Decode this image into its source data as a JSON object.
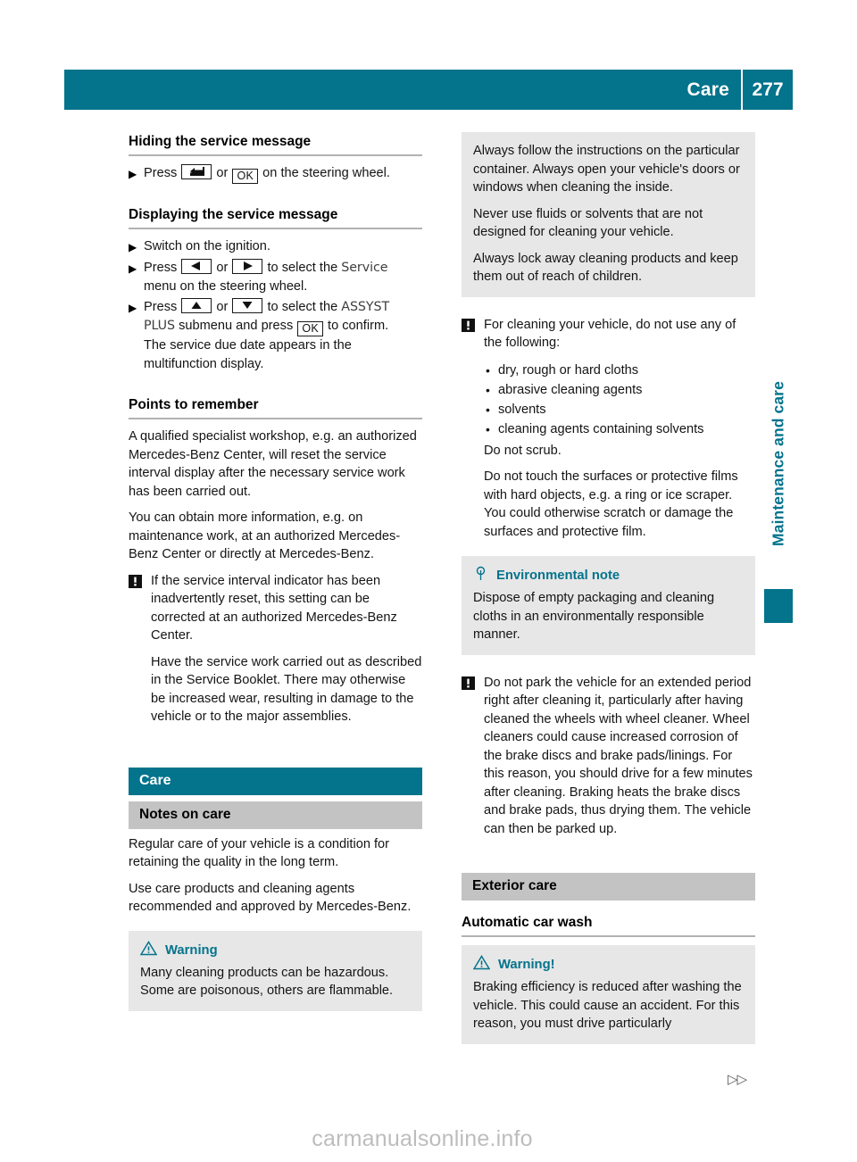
{
  "header": {
    "title": "Care",
    "page_number": "277",
    "accent_color": "#04738c"
  },
  "side_tab": {
    "label": "Maintenance and care"
  },
  "left_column": {
    "section_1": {
      "heading": "Hiding the service message",
      "steps": [
        {
          "parts": [
            {
              "type": "text",
              "value": "Press "
            },
            {
              "type": "key",
              "icon": "back-key-icon"
            },
            {
              "type": "text",
              "value": " or "
            },
            {
              "type": "key",
              "label": "OK"
            },
            {
              "type": "text",
              "value": " on the steering wheel."
            }
          ]
        }
      ]
    },
    "section_2": {
      "heading": "Displaying the service message",
      "step_1": "Switch on the ignition.",
      "step_2_a": "Press ",
      "step_2_or": " or ",
      "step_2_b": " to select the ",
      "step_2_mono": "Service",
      "step_2_c": "menu on the steering wheel.",
      "step_3_a": "Press ",
      "step_3_or": " or ",
      "step_3_b": " to select the ",
      "step_3_mono1": "ASSYST",
      "step_3_mono2": "PLUS",
      "step_3_c": " submenu and press ",
      "step_3_ok": "OK",
      "step_3_d": " to confirm.",
      "step_3_e": "The service due date appears in the multifunction display."
    },
    "section_3": {
      "heading": "Points to remember",
      "paragraphs": [
        "A qualified specialist workshop, e.g. an authorized Mercedes-Benz Center, will reset the service interval display after the necessary service work has been carried out.",
        "You can obtain more information, e.g. on maintenance work, at an authorized Mercedes-Benz Center or directly at Mercedes-Benz."
      ],
      "caution": {
        "icon": "caution-exclamation-icon",
        "paragraphs": [
          "If the service interval indicator has been inadvertently reset, this setting can be corrected at an authorized Mercedes-Benz Center.",
          "Have the service work carried out as described in the Service Booklet. There may otherwise be increased wear, resulting in damage to the vehicle or to the major assemblies."
        ]
      }
    },
    "care_banner": "Care",
    "notes_banner": "Notes on care",
    "notes_paragraphs": [
      "Regular care of your vehicle is a condition for retaining the quality in the long term.",
      "Use care products and cleaning agents recommended and approved by Mercedes-Benz."
    ],
    "warning_box": {
      "icon": "warning-triangle-icon",
      "title": "Warning",
      "paragraphs": [
        "Many cleaning products can be hazardous. Some are poisonous, others are flammable."
      ]
    }
  },
  "right_column": {
    "warning_box_continued": {
      "paragraphs": [
        "Always follow the instructions on the particular container. Always open your vehicle's doors or windows when cleaning the inside.",
        "Never use fluids or solvents that are not designed for cleaning your vehicle.",
        "Always lock away cleaning products and keep them out of reach of children."
      ]
    },
    "caution_1": {
      "icon": "caution-exclamation-icon",
      "intro": "For cleaning your vehicle, do not use any of the following:",
      "bullets": [
        "dry, rough or hard cloths",
        "abrasive cleaning agents",
        "solvents",
        "cleaning agents containing solvents"
      ],
      "paragraphs": [
        "Do not scrub.",
        "Do not touch the surfaces or protective films with hard objects, e.g. a ring or ice scraper. You could otherwise scratch or damage the surfaces and protective film."
      ]
    },
    "environmental_note": {
      "icon": "environment-tree-icon",
      "title": "Environmental note",
      "paragraphs": [
        "Dispose of empty packaging and cleaning cloths in an environmentally responsible manner."
      ]
    },
    "caution_2": {
      "icon": "caution-exclamation-icon",
      "paragraphs": [
        "Do not park the vehicle for an extended period right after cleaning it, particularly after having cleaned the wheels with wheel cleaner. Wheel cleaners could cause increased corrosion of the brake discs and brake pads/linings. For this reason, you should drive for a few minutes after cleaning. Braking heats the brake discs and brake pads, thus drying them. The vehicle can then be parked up."
      ]
    },
    "exterior_banner": "Exterior care",
    "auto_wash_heading": "Automatic car wash",
    "warning_box": {
      "icon": "warning-triangle-icon",
      "title": "Warning!",
      "paragraphs": [
        "Braking efficiency is reduced after washing the vehicle. This could cause an accident. For this reason, you must drive particularly"
      ]
    }
  },
  "footer": {
    "continue_glyph": "▷▷",
    "watermark": "carmanualsonline.info"
  }
}
